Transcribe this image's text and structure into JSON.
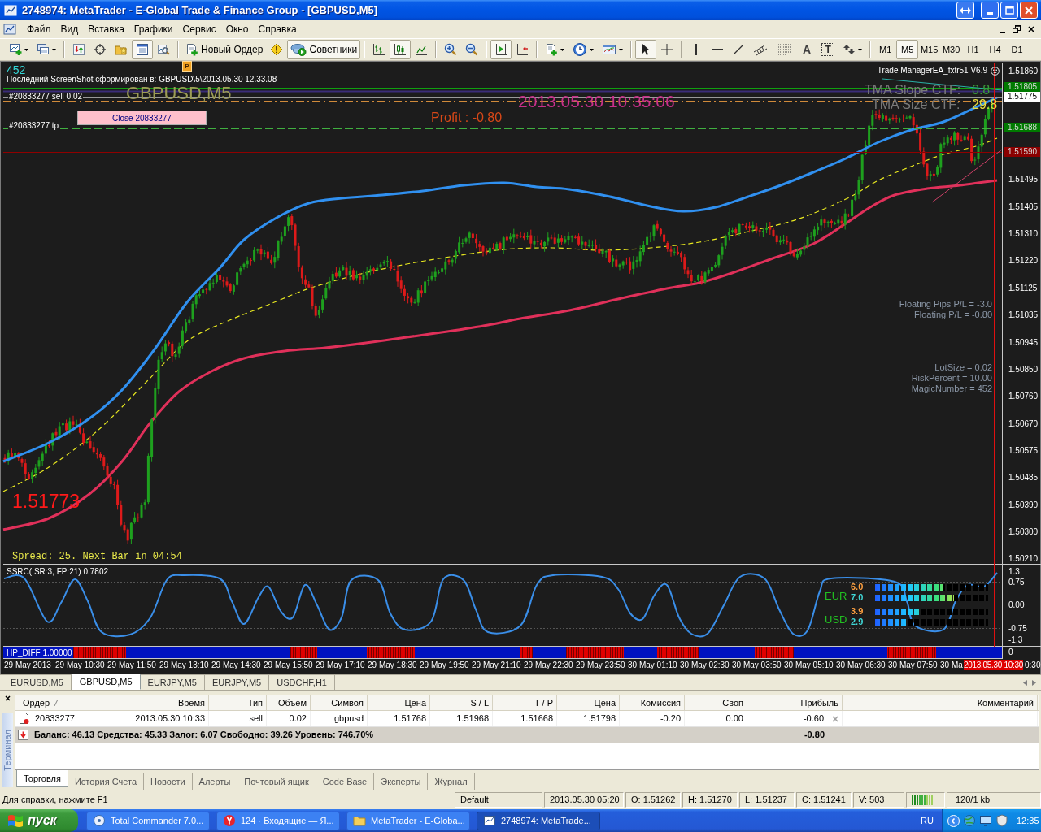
{
  "window": {
    "title": "2748974: MetaTrader - E-Global Trade & Finance Group - [GBPUSD,M5]"
  },
  "menu": [
    "Файл",
    "Вид",
    "Вставка",
    "Графики",
    "Сервис",
    "Окно",
    "Справка"
  ],
  "toolbar": {
    "items": [
      {
        "kind": "icon",
        "pressed": false
      },
      {
        "kind": "icon",
        "pressed": false
      },
      {
        "kind": "separator"
      },
      {
        "kind": "icon",
        "pressed": false
      },
      {
        "kind": "icon",
        "pressed": false
      },
      {
        "kind": "icon",
        "pressed": false
      },
      {
        "kind": "icon",
        "pressed": true
      },
      {
        "kind": "icon",
        "pressed": false
      },
      {
        "kind": "separator"
      },
      {
        "kind": "text",
        "label": "Новый Ордер",
        "pressed": false
      },
      {
        "kind": "icon",
        "pressed": false
      },
      {
        "kind": "text",
        "label": "Советники",
        "pressed": true
      },
      {
        "kind": "separator"
      },
      {
        "kind": "icon",
        "pressed": false
      },
      {
        "kind": "icon",
        "pressed": true
      },
      {
        "kind": "icon",
        "pressed": false
      },
      {
        "kind": "separator"
      },
      {
        "kind": "icon",
        "pressed": false
      },
      {
        "kind": "icon",
        "pressed": false
      },
      {
        "kind": "separator"
      },
      {
        "kind": "icon",
        "pressed": true
      },
      {
        "kind": "icon",
        "pressed": false
      },
      {
        "kind": "separator"
      },
      {
        "kind": "icon",
        "pressed": false
      },
      {
        "kind": "icon",
        "pressed": false
      },
      {
        "kind": "icon",
        "pressed": false
      },
      {
        "kind": "separator"
      },
      {
        "kind": "icon",
        "pressed": true
      },
      {
        "kind": "icon",
        "pressed": false
      },
      {
        "kind": "separator"
      },
      {
        "kind": "icon",
        "pressed": false
      },
      {
        "kind": "icon",
        "pressed": false
      },
      {
        "kind": "icon",
        "pressed": false
      },
      {
        "kind": "icon",
        "pressed": false
      },
      {
        "kind": "icon",
        "pressed": false
      },
      {
        "kind": "glyph",
        "label": "A",
        "pressed": false
      },
      {
        "kind": "framed_glyph",
        "label": "T",
        "pressed": false
      },
      {
        "kind": "icon",
        "pressed": false
      },
      {
        "kind": "separator"
      }
    ],
    "periods": [
      {
        "label": "M1",
        "selected": false
      },
      {
        "label": "M5",
        "selected": true
      },
      {
        "label": "M15",
        "selected": false
      },
      {
        "label": "M30",
        "selected": false
      },
      {
        "label": "H1",
        "selected": false
      },
      {
        "label": "H4",
        "selected": false
      },
      {
        "label": "D1",
        "selected": false
      }
    ]
  },
  "chart": {
    "magic_label": "452",
    "marker": "P",
    "screenshot_note": "Последний ScreenShot сформирован в: GBPUSD\\5\\2013.05.30 12.33.08",
    "symbol": "GBPUSD,M5",
    "order_labels": [
      "#20833277 sell 0.02",
      "#20833277 tp"
    ],
    "close_button": "Close 20833277",
    "server_time": "2013.05.30 10:35:06",
    "profit": "Profit : -0.80",
    "expert_name": "Trade ManagerEA_fxtr51 V6.9",
    "tma": [
      {
        "label": "TMA Slope CTF:",
        "value": "0.8"
      },
      {
        "label": "TMA Size CTF:",
        "value": "29.8"
      }
    ],
    "floating": [
      "Floating Pips P/L = -3.0",
      "Floating P/L = -0.80"
    ],
    "settings": [
      "LotSize = 0.02",
      "RiskPercent = 10.00",
      "MagicNumber = 452"
    ],
    "last_price": "1.51773",
    "spread_info": "Spread: 25. Next Bar in 04:54",
    "price_axis": {
      "labels": [
        "1.51860",
        "1.51495",
        "1.51405",
        "1.51310",
        "1.51220",
        "1.51125",
        "1.51035",
        "1.50945",
        "1.50850",
        "1.50760",
        "1.50670",
        "1.50575",
        "1.50485",
        "1.50390",
        "1.50300",
        "1.50210"
      ],
      "tags": [
        {
          "text": "1.51805",
          "color": "#007a00"
        },
        {
          "text": "1.51775",
          "color": "#ffffff"
        },
        {
          "text": "1.51688",
          "color": "#007a00"
        },
        {
          "text": "1.51590",
          "color": "#8b0000"
        }
      ]
    }
  },
  "indicator": {
    "title": "SSRC( SR:3, FP:21) 0.7802",
    "axis": [
      "1.3",
      "0.75",
      "0.00",
      "-0.75",
      "-1.3"
    ],
    "currencies": [
      {
        "name": "EUR",
        "meters": [
          {
            "reading": "6.0",
            "level": 0.6,
            "color": "#ffa040"
          },
          {
            "reading": "7.0",
            "level": 0.7,
            "color": "#40d8d8"
          }
        ]
      },
      {
        "name": "USD",
        "meters": [
          {
            "reading": "3.9",
            "level": 0.39,
            "color": "#ffa040"
          },
          {
            "reading": "2.9",
            "level": 0.29,
            "color": "#40d8d8"
          }
        ]
      }
    ]
  },
  "histogram": {
    "title": "HP_DIFF 1.00000",
    "axis": [
      "0"
    ]
  },
  "time_axis": {
    "labels": [
      "29 May 2013",
      "29 May 10:30",
      "29 May 11:50",
      "29 May 13:10",
      "29 May 14:30",
      "29 May 15:50",
      "29 May 17:10",
      "29 May 18:30",
      "29 May 19:50",
      "29 May 21:10",
      "29 May 22:30",
      "29 May 23:50",
      "30 May 01:10",
      "30 May 02:30",
      "30 May 03:50",
      "30 May 05:10",
      "30 May 06:30",
      "30 May 07:50",
      "30 Ma"
    ],
    "current": "2013.05.30 10:30",
    "tail": "0:30"
  },
  "chart_tabs": [
    {
      "label": "EURUSD,M5",
      "selected": false
    },
    {
      "label": "GBPUSD,M5",
      "selected": true
    },
    {
      "label": "EURJPY,M5",
      "selected": false
    },
    {
      "label": "EURJPY,M5",
      "selected": false
    },
    {
      "label": "USDCHF,H1",
      "selected": false
    }
  ],
  "terminal": {
    "title": "Терминал",
    "columns": [
      "Ордер",
      "Время",
      "Тип",
      "Объём",
      "Символ",
      "Цена",
      "S / L",
      "T / P",
      "Цена",
      "Комиссия",
      "Своп",
      "Прибыль",
      "Комментарий"
    ],
    "rows": [
      {
        "cells": [
          "20833277",
          "2013.05.30 10:33",
          "sell",
          "0.02",
          "gbpusd",
          "1.51768",
          "1.51968",
          "1.51668",
          "1.51798",
          "-0.20",
          "0.00",
          "-0.60"
        ]
      }
    ],
    "summary": {
      "text": "Баланс: 46.13 Средства: 45.33 Залог: 6.07 Свободно: 39.26 Уровень: 746.70%",
      "profit": "-0.80"
    },
    "tabs": [
      {
        "label": "Торговля",
        "selected": true
      },
      {
        "label": "История Счета",
        "selected": false
      },
      {
        "label": "Новости",
        "selected": false
      },
      {
        "label": "Алерты",
        "selected": false
      },
      {
        "label": "Почтовый ящик",
        "selected": false
      },
      {
        "label": "Code Base",
        "selected": false
      },
      {
        "label": "Эксперты",
        "selected": false
      },
      {
        "label": "Журнал",
        "selected": false
      }
    ]
  },
  "status_bar": {
    "help": "Для справки, нажмите F1",
    "profile": "Default",
    "bar_time": "2013.05.30 05:20",
    "ohlc": [
      "O: 1.51262",
      "H: 1.51270",
      "L: 1.51237",
      "C: 1.51241"
    ],
    "volume": "V: 503",
    "traffic": "120/1 kb"
  },
  "taskbar": {
    "start": "пуск",
    "tasks": [
      {
        "label": "Total Commander 7.0...",
        "selected": false
      },
      {
        "label": "124 · Входящие — Я...",
        "selected": false
      },
      {
        "label": "MetaTrader - E-Globa...",
        "selected": false
      },
      {
        "label": "2748974: MetaTrade...",
        "selected": true
      }
    ],
    "language": "RU",
    "clock": "12:35"
  }
}
